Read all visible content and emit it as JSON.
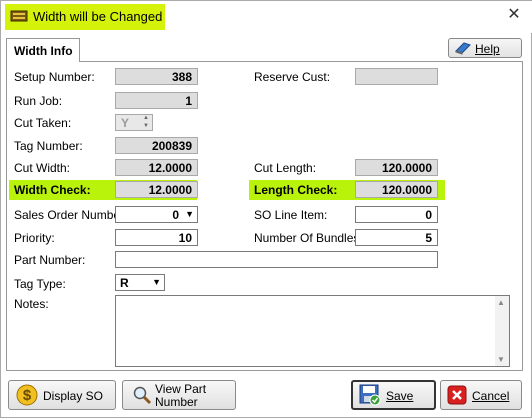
{
  "window": {
    "title": "Width will be Changed",
    "close_glyph": "✕"
  },
  "tabs": [
    {
      "label": "Width Info"
    }
  ],
  "help": {
    "label": "Help",
    "icon": "help-book-icon"
  },
  "fields": {
    "setup_number": {
      "label": "Setup Number:",
      "value": "388"
    },
    "reserve_cust": {
      "label": "Reserve Cust:",
      "value": ""
    },
    "run_job": {
      "label": "Run Job:",
      "value": "1"
    },
    "cut_taken": {
      "label": "Cut Taken:",
      "value": "Y"
    },
    "tag_number": {
      "label": "Tag Number:",
      "value": "200839"
    },
    "cut_width": {
      "label": "Cut Width:",
      "value": "12.0000"
    },
    "cut_length": {
      "label": "Cut Length:",
      "value": "120.0000"
    },
    "width_check": {
      "label": "Width Check:",
      "value": "12.0000"
    },
    "length_check": {
      "label": "Length Check:",
      "value": "120.0000"
    },
    "sales_order_number": {
      "label": "Sales Order Number:",
      "value": "0"
    },
    "so_line_item": {
      "label": "SO Line Item:",
      "value": "0"
    },
    "priority": {
      "label": "Priority:",
      "value": "10"
    },
    "number_of_bundles": {
      "label": "Number Of Bundles:",
      "value": "5"
    },
    "part_number": {
      "label": "Part Number:",
      "value": ""
    },
    "tag_type": {
      "label": "Tag Type:",
      "value": "R"
    },
    "notes": {
      "label": "Notes:",
      "value": ""
    }
  },
  "buttons": {
    "display_so": "Display SO",
    "view_part_number_line1": "View Part",
    "view_part_number_line2": "Number",
    "save": "Save",
    "cancel": "Cancel"
  },
  "colors": {
    "highlight": "#b9f20a",
    "title_highlight": "#d5f20a"
  }
}
